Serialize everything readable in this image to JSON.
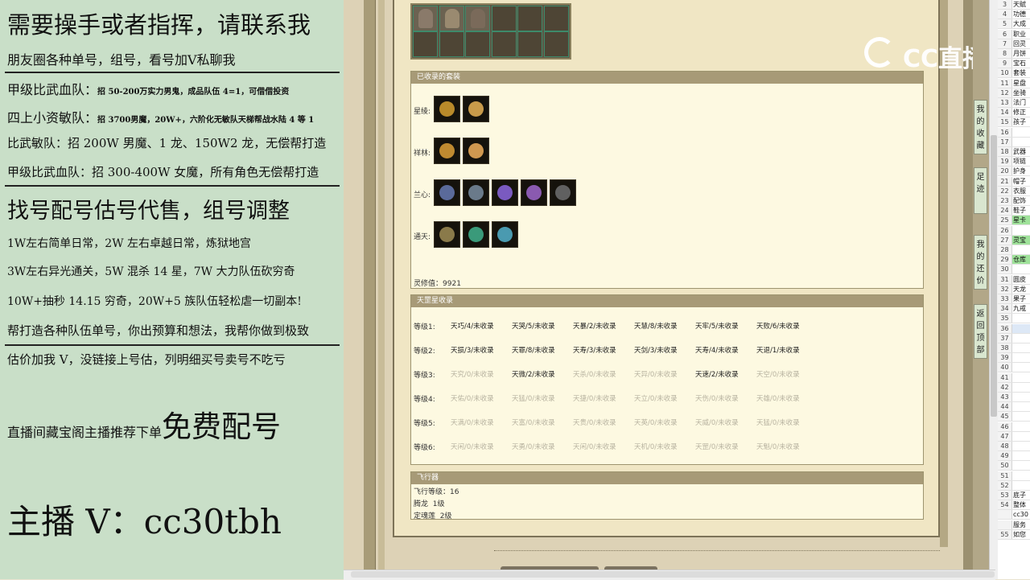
{
  "left_panel": {
    "line1": "需要操手或者指挥，请联系我",
    "line2": "朋友圈各种单号，组号，看号加V私聊我",
    "line3_head": "甲级比武血队：",
    "line3_body": "招 50-200万实力男鬼，成品队伍 4=1，可借借投资",
    "line4_head": "四上小资敏队：",
    "line4_body": "招 3700男魔，20W+，六阶化无敏队天梯帮战水陆 4 等 1",
    "line5": "比武敏队：招 200W 男魔、1 龙、150W2 龙，无偿帮打造",
    "line6": "甲级比武血队：招 300-400W 女魔，所有角色无偿帮打造",
    "line7": "找号配号估号代售，组号调整",
    "line8": "1W左右简单日常，2W 左右卓越日常，炼狱地宫",
    "line9": "3W左右异光通关，5W 混杀 14 星，7W 大力队伍砍穷奇",
    "line10": "10W+抽秒 14.15 穷奇，20W+5 族队伍轻松虐一切副本!",
    "line11": "帮打造各种队伍单号，你出预算和想法，我帮你做到极致",
    "line12": "估价加我 V，没链接上号估，列明细买号卖号不吃亏",
    "line13_small": "直播间藏宝阁主播推荐下单",
    "line13_big": "免费配号",
    "line14": "主播 V：cc30tbh"
  },
  "logo": {
    "text": "CC直播"
  },
  "collected_sets": {
    "header": "已收录的套装",
    "rows": [
      {
        "label": "星绫:",
        "count": 2,
        "colors": [
          "#b98a2a",
          "#c89a4a"
        ]
      },
      {
        "label": "祥林:",
        "count": 2,
        "colors": [
          "#c08a30",
          "#d09850"
        ]
      },
      {
        "label": "兰心:",
        "count": 5,
        "colors": [
          "#5a6a9a",
          "#6a7a8a",
          "#7a5ac0",
          "#8a5ab0",
          "#606060"
        ]
      },
      {
        "label": "通天:",
        "count": 3,
        "colors": [
          "#8a7a4a",
          "#3a9a7a",
          "#4a9ab0"
        ]
      }
    ],
    "score_label": "灵修值：",
    "score_value": "9921"
  },
  "tiangang": {
    "header": "天罡星收录",
    "rows": [
      {
        "label": "等级1:",
        "cells": [
          {
            "text": "天巧/4/未收录",
            "on": true
          },
          {
            "text": "天哭/5/未收录",
            "on": true
          },
          {
            "text": "天暴/2/未收录",
            "on": true
          },
          {
            "text": "天慧/8/未收录",
            "on": true
          },
          {
            "text": "天牢/5/未收录",
            "on": true
          },
          {
            "text": "天败/6/未收录",
            "on": true
          }
        ]
      },
      {
        "label": "等级2:",
        "cells": [
          {
            "text": "天损/3/未收录",
            "on": true
          },
          {
            "text": "天罪/8/未收录",
            "on": true
          },
          {
            "text": "天寿/3/未收录",
            "on": true
          },
          {
            "text": "天剑/3/未收录",
            "on": true
          },
          {
            "text": "天寿/4/未收录",
            "on": true
          },
          {
            "text": "天退/1/未收录",
            "on": true
          }
        ]
      },
      {
        "label": "等级3:",
        "cells": [
          {
            "text": "天究/0/未收录",
            "on": false
          },
          {
            "text": "天微/2/未收录",
            "on": true
          },
          {
            "text": "天杀/0/未收录",
            "on": false
          },
          {
            "text": "天异/0/未收录",
            "on": false
          },
          {
            "text": "天速/2/未收录",
            "on": true
          },
          {
            "text": "天空/0/未收录",
            "on": false
          }
        ]
      },
      {
        "label": "等级4:",
        "cells": [
          {
            "text": "天佑/0/未收录",
            "on": false
          },
          {
            "text": "天猛/0/未收录",
            "on": false
          },
          {
            "text": "天捷/0/未收录",
            "on": false
          },
          {
            "text": "天立/0/未收录",
            "on": false
          },
          {
            "text": "天伤/0/未收录",
            "on": false
          },
          {
            "text": "天雄/0/未收录",
            "on": false
          }
        ]
      },
      {
        "label": "等级5:",
        "cells": [
          {
            "text": "天满/0/未收录",
            "on": false
          },
          {
            "text": "天富/0/未收录",
            "on": false
          },
          {
            "text": "天贵/0/未收录",
            "on": false
          },
          {
            "text": "天英/0/未收录",
            "on": false
          },
          {
            "text": "天威/0/未收录",
            "on": false
          },
          {
            "text": "天猛/0/未收录",
            "on": false
          }
        ]
      },
      {
        "label": "等级6:",
        "cells": [
          {
            "text": "天闲/0/未收录",
            "on": false
          },
          {
            "text": "天勇/0/未收录",
            "on": false
          },
          {
            "text": "天闲/0/未收录",
            "on": false
          },
          {
            "text": "天机/0/未收录",
            "on": false
          },
          {
            "text": "天罡/0/未收录",
            "on": false
          },
          {
            "text": "天魁/0/未收录",
            "on": false
          }
        ]
      }
    ]
  },
  "flight": {
    "header": "飞行器",
    "level_label": "飞行等级：",
    "level_value": "16",
    "dragon_label": "腾龙",
    "dragon_value": "1级",
    "lotus_label": "定魂莲",
    "lotus_value": "2级"
  },
  "side_tabs": [
    {
      "text": "我的收藏"
    },
    {
      "text": "足迹"
    },
    {
      "text": "我的还价"
    },
    {
      "text": "返回顶部"
    }
  ],
  "sheet_rows": [
    {
      "n": "3",
      "v": "天赋",
      "hl": ""
    },
    {
      "n": "4",
      "v": "功德",
      "hl": ""
    },
    {
      "n": "5",
      "v": "大成",
      "hl": ""
    },
    {
      "n": "6",
      "v": "职业",
      "hl": ""
    },
    {
      "n": "7",
      "v": "回灵",
      "hl": ""
    },
    {
      "n": "8",
      "v": "月饼",
      "hl": ""
    },
    {
      "n": "9",
      "v": "宝石",
      "hl": ""
    },
    {
      "n": "10",
      "v": "套装",
      "hl": ""
    },
    {
      "n": "11",
      "v": "星盘",
      "hl": ""
    },
    {
      "n": "12",
      "v": "坐骑",
      "hl": ""
    },
    {
      "n": "13",
      "v": "法门",
      "hl": ""
    },
    {
      "n": "14",
      "v": "修正",
      "hl": ""
    },
    {
      "n": "15",
      "v": "孩子",
      "hl": ""
    },
    {
      "n": "16",
      "v": "",
      "hl": ""
    },
    {
      "n": "17",
      "v": "",
      "hl": ""
    },
    {
      "n": "18",
      "v": "武器",
      "hl": ""
    },
    {
      "n": "19",
      "v": "项链",
      "hl": ""
    },
    {
      "n": "20",
      "v": "护身",
      "hl": ""
    },
    {
      "n": "21",
      "v": "帽子",
      "hl": ""
    },
    {
      "n": "22",
      "v": "衣服",
      "hl": ""
    },
    {
      "n": "23",
      "v": "配饰",
      "hl": ""
    },
    {
      "n": "24",
      "v": "鞋子",
      "hl": ""
    },
    {
      "n": "25",
      "v": "星卡",
      "hl": "#9fe29a"
    },
    {
      "n": "26",
      "v": "",
      "hl": ""
    },
    {
      "n": "27",
      "v": "灵宝",
      "hl": "#9fe29a"
    },
    {
      "n": "28",
      "v": "",
      "hl": ""
    },
    {
      "n": "29",
      "v": "仓库",
      "hl": "#9fe29a"
    },
    {
      "n": "30",
      "v": "",
      "hl": ""
    },
    {
      "n": "31",
      "v": "圆皮",
      "hl": ""
    },
    {
      "n": "32",
      "v": "天龙",
      "hl": ""
    },
    {
      "n": "33",
      "v": "果子",
      "hl": ""
    },
    {
      "n": "34",
      "v": "九戒",
      "hl": ""
    },
    {
      "n": "35",
      "v": "",
      "hl": ""
    },
    {
      "n": "36",
      "v": "",
      "hl": "#dde8f6"
    },
    {
      "n": "37",
      "v": "",
      "hl": ""
    },
    {
      "n": "38",
      "v": "",
      "hl": ""
    },
    {
      "n": "39",
      "v": "",
      "hl": ""
    },
    {
      "n": "40",
      "v": "",
      "hl": ""
    },
    {
      "n": "41",
      "v": "",
      "hl": ""
    },
    {
      "n": "42",
      "v": "",
      "hl": ""
    },
    {
      "n": "43",
      "v": "",
      "hl": ""
    },
    {
      "n": "44",
      "v": "",
      "hl": ""
    },
    {
      "n": "45",
      "v": "",
      "hl": ""
    },
    {
      "n": "46",
      "v": "",
      "hl": ""
    },
    {
      "n": "47",
      "v": "",
      "hl": ""
    },
    {
      "n": "48",
      "v": "",
      "hl": ""
    },
    {
      "n": "49",
      "v": "",
      "hl": ""
    },
    {
      "n": "50",
      "v": "",
      "hl": ""
    },
    {
      "n": "51",
      "v": "",
      "hl": ""
    },
    {
      "n": "52",
      "v": "",
      "hl": ""
    },
    {
      "n": "53",
      "v": "底子",
      "hl": ""
    },
    {
      "n": "54",
      "v": "整体",
      "hl": ""
    },
    {
      "n": "",
      "v": "cc30",
      "hl": ""
    },
    {
      "n": "",
      "v": "服务",
      "hl": ""
    },
    {
      "n": "55",
      "v": "如您",
      "hl": ""
    }
  ],
  "inventory": {
    "filled": [
      true,
      true,
      true,
      false,
      false,
      false,
      false,
      false,
      false,
      false,
      false,
      false
    ],
    "colors": [
      "#8a7a6a",
      "#9a8a70",
      "#7a6a5a"
    ]
  }
}
